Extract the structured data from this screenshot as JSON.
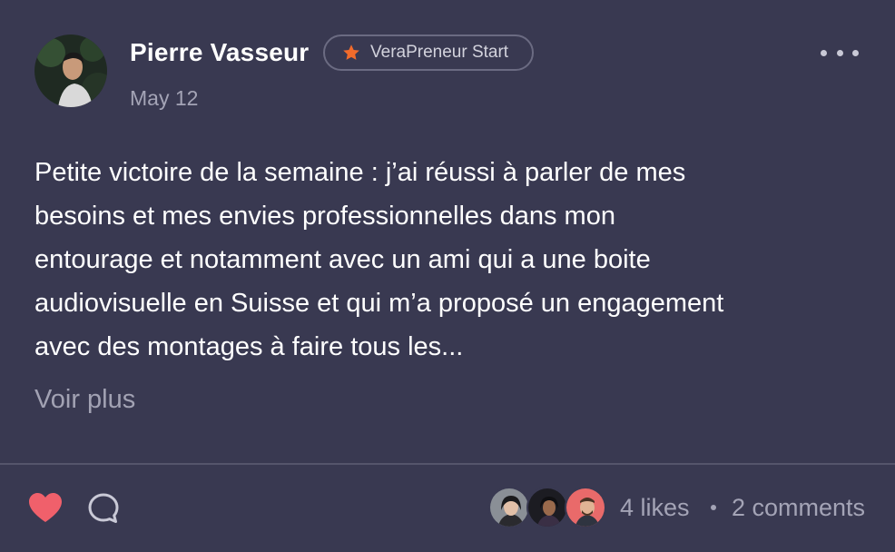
{
  "post": {
    "author": {
      "name": "Pierre Vasseur",
      "badge": "VeraPreneur Start",
      "avatar_icon": "user-avatar-photo"
    },
    "date": "May 12",
    "body_lines": [
      "Petite victoire de la semaine : j’ai réussi à parler de mes",
      "besoins et mes envies professionnelles dans mon",
      "entourage et notamment avec un ami qui a une boite",
      "audiovisuelle en Suisse et qui m’a proposé un engagement",
      "avec des montages à faire tous les..."
    ],
    "see_more": "Voir plus"
  },
  "footer": {
    "liked": true,
    "likes": "4 likes",
    "comments": "2 comments",
    "liker_avatars": [
      "liker-avatar-1",
      "liker-avatar-2",
      "liker-avatar-3"
    ]
  },
  "colors": {
    "background": "#393951",
    "heart": "#f0606b",
    "badge_star": "#f26b2b",
    "muted_text": "#a4a4b6"
  }
}
